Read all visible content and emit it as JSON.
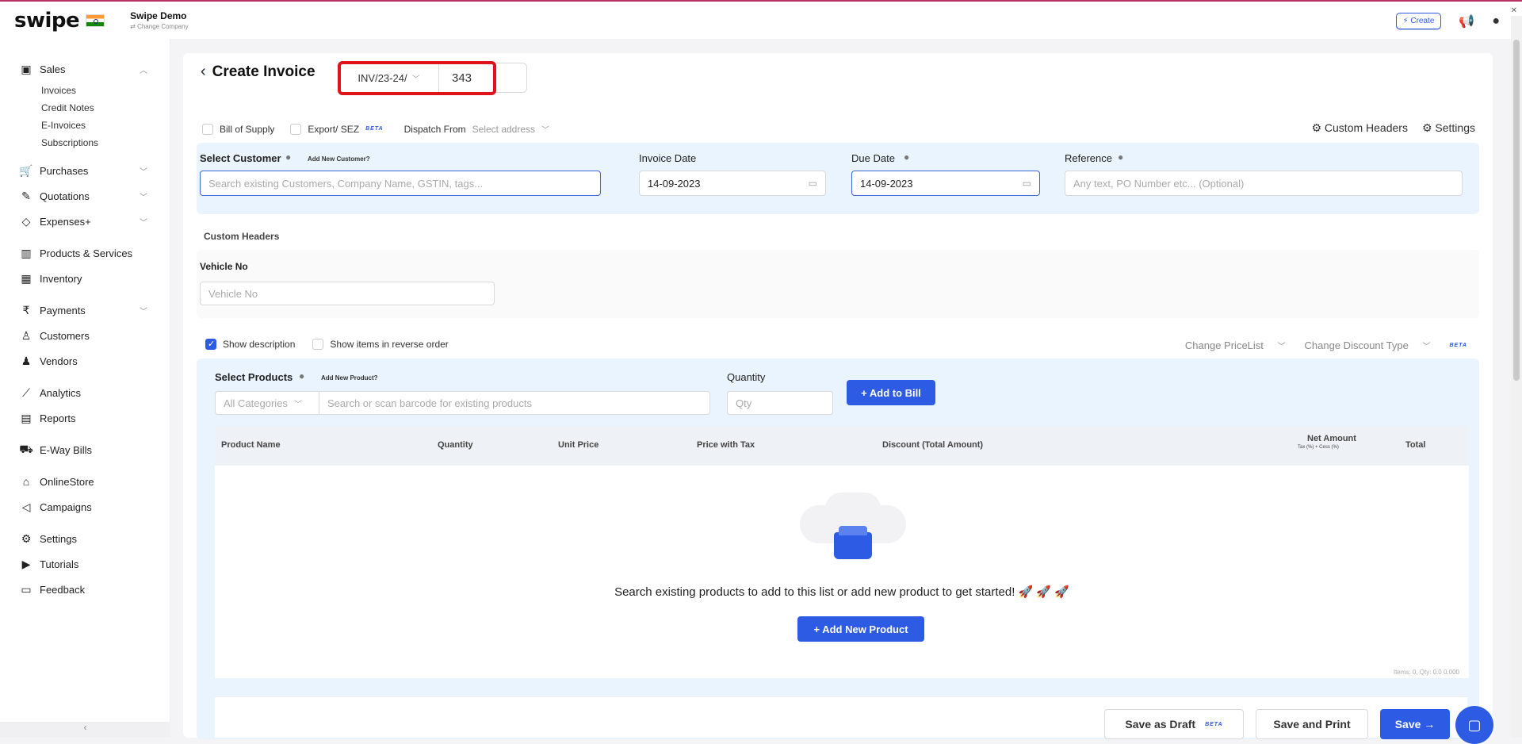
{
  "topbar": {
    "logo": "swipe",
    "company_name": "Swipe Demo",
    "change_company": "⇄ Change Company",
    "create_label": "⚡ Create"
  },
  "sidebar": {
    "sales": "Sales",
    "sales_sub": [
      "Invoices",
      "Credit Notes",
      "E-Invoices",
      "Subscriptions"
    ],
    "purchases": "Purchases",
    "quotations": "Quotations",
    "expenses": "Expenses+",
    "products": "Products & Services",
    "inventory": "Inventory",
    "payments": "Payments",
    "customers": "Customers",
    "vendors": "Vendors",
    "analytics": "Analytics",
    "reports": "Reports",
    "eway": "E-Way Bills",
    "onlinestore": "OnlineStore",
    "campaigns": "Campaigns",
    "settings": "Settings",
    "tutorials": "Tutorials",
    "feedback": "Feedback",
    "collapse": "‹"
  },
  "header": {
    "title": "Create Invoice",
    "inv_prefix": "INV/23-24/",
    "inv_number": "343"
  },
  "options": {
    "bill_of_supply": "Bill of Supply",
    "export_sez": "Export/ SEZ",
    "beta": "BETA",
    "dispatch_from": "Dispatch From",
    "select_address": "Select address",
    "custom_headers": "Custom Headers",
    "settings": "Settings"
  },
  "customer": {
    "label": "Select Customer",
    "add_new": "Add New Customer?",
    "placeholder": "Search existing Customers, Company Name, GSTIN, tags...",
    "invoice_date_label": "Invoice Date",
    "invoice_date": "14-09-2023",
    "due_date_label": "Due Date",
    "due_date": "14-09-2023",
    "reference_label": "Reference",
    "reference_placeholder": "Any text, PO Number etc... (Optional)"
  },
  "custom_headers": {
    "title": "Custom Headers",
    "vehicle_label": "Vehicle No",
    "vehicle_placeholder": "Vehicle No"
  },
  "product_opts": {
    "show_description": "Show description",
    "reverse_order": "Show items in reverse order",
    "change_pricelist": "Change PriceList",
    "change_discount": "Change Discount Type",
    "beta": "BETA"
  },
  "products": {
    "label": "Select Products",
    "add_new": "Add New Product?",
    "categories": "All Categories",
    "search_placeholder": "Search or scan barcode for existing products",
    "qty_label": "Quantity",
    "qty_placeholder": "Qty",
    "add_to_bill": "+ Add to Bill"
  },
  "table": {
    "headers": [
      "Product Name",
      "Quantity",
      "Unit Price",
      "Price with Tax",
      "Discount (Total Amount)",
      "Net Amount",
      "Total"
    ],
    "net_sub": "Tax (%) + Cess (%)",
    "empty_text": "Search existing products to add to this list or add new product to get started! 🚀 🚀 🚀",
    "add_new_product": "+ Add New Product",
    "items_qty": "Items: 0, Qty: 0.0 0.000"
  },
  "footer": {
    "save_draft": "Save as Draft",
    "beta": "BETA",
    "save_print": "Save and Print",
    "save": "Save →"
  },
  "colors": {
    "primary": "#2d5be3",
    "highlight": "#e0131a",
    "panel": "#eaf4fe"
  }
}
